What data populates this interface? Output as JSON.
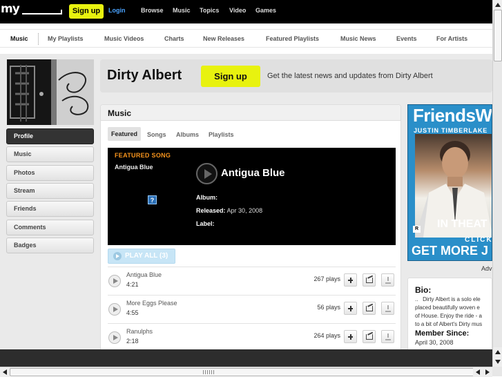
{
  "topbar": {
    "logo": "my",
    "signup_label": "Sign up",
    "login_label": "Login",
    "nav": [
      "Browse",
      "Music",
      "Topics",
      "Video",
      "Games"
    ]
  },
  "subnav": [
    "Music",
    "My Playlists",
    "Music Videos",
    "Charts",
    "New Releases",
    "Featured Playlists",
    "Music News",
    "Events",
    "For Artists"
  ],
  "left_menu": [
    "Profile",
    "Music",
    "Photos",
    "Stream",
    "Friends",
    "Comments",
    "Badges"
  ],
  "header": {
    "artist": "Dirty Albert",
    "signup_label": "Sign up",
    "tagline": "Get the latest news and updates from Dirty Albert"
  },
  "music": {
    "title": "Music",
    "tabs": [
      "Featured",
      "Songs",
      "Albums",
      "Playlists"
    ],
    "featured": {
      "label": "FEATURED SONG",
      "song": "Antigua Blue",
      "missing_image_glyph": "?",
      "title": "Antigua Blue",
      "album_label": "Album:",
      "album_value": "",
      "released_label": "Released:",
      "released_value": "Apr 30, 2008",
      "label_label": "Label:",
      "label_value": ""
    },
    "play_all": "PLAY ALL (3)",
    "tracks": [
      {
        "name": "Antigua Blue",
        "duration": "4:21",
        "plays": "267 plays"
      },
      {
        "name": "More Eggs Please",
        "duration": "4:55",
        "plays": "56 plays"
      },
      {
        "name": "Ranulphs",
        "duration": "2:18",
        "plays": "264 plays"
      }
    ]
  },
  "ad": {
    "title": "FriendsW",
    "subtitle": "JUSTIN TIMBERLAKE",
    "in_theaters": "IN THEAT",
    "click": "CLICK",
    "get_more": "GET MORE J",
    "rating": "R",
    "adv_label": "Adv"
  },
  "bio": {
    "title": "Bio:",
    "text_lines": [
      "..   Dirty Albert is a solo ele",
      "placed beautifully woven e",
      "of House. Enjoy the ride - a",
      "to a bit of Albert's Dirty mus"
    ],
    "member_since_label": "Member Since:",
    "member_since": "April 30, 2008"
  },
  "colors": {
    "brand_yellow": "#e8f20f",
    "featured_orange": "#f7941d",
    "login_blue": "#4aa3ff"
  }
}
